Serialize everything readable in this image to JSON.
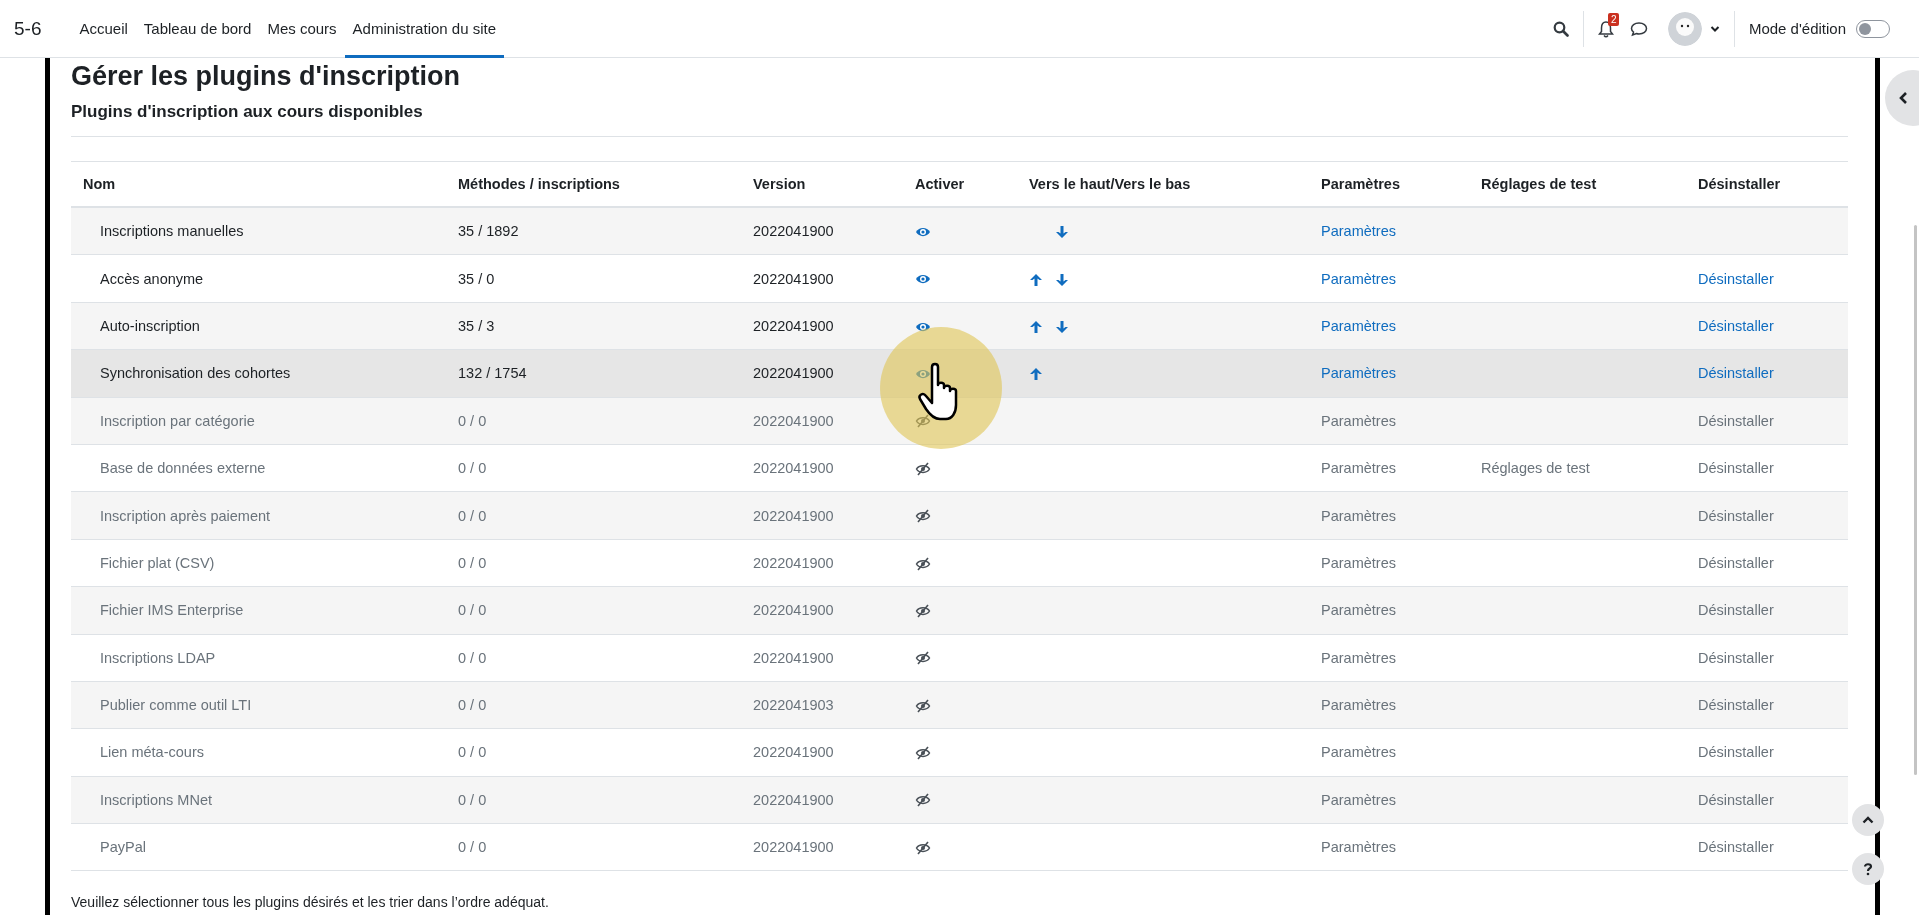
{
  "navbar": {
    "brand": "5-6",
    "items": [
      {
        "label": "Accueil",
        "selected": false
      },
      {
        "label": "Tableau de bord",
        "selected": false
      },
      {
        "label": "Mes cours",
        "selected": false
      },
      {
        "label": "Administration du site",
        "selected": true
      }
    ],
    "notifications_badge": "2",
    "edit_mode": {
      "label": "Mode d'édition",
      "on": false
    }
  },
  "page_title": "Gérer les plugins d'inscription",
  "section_title": "Plugins d'inscription aux cours disponibles",
  "table": {
    "columns": [
      "Nom",
      "Méthodes / inscriptions",
      "Version",
      "Activer",
      "Vers le haut/Vers le bas",
      "Paramètres",
      "Réglages de test",
      "Désinstaller"
    ],
    "rows": [
      {
        "name": "Inscriptions manuelles",
        "counts": "35 / 1892",
        "version": "2022041900",
        "enabled": true,
        "up": false,
        "down": true,
        "settings": "Paramètres",
        "uninstall": null,
        "hovered": false
      },
      {
        "name": "Accès anonyme",
        "counts": "35 / 0",
        "version": "2022041900",
        "enabled": true,
        "up": true,
        "down": true,
        "settings": "Paramètres",
        "uninstall": "Désinstaller",
        "hovered": false
      },
      {
        "name": "Auto-inscription",
        "counts": "35 / 3",
        "version": "2022041900",
        "enabled": true,
        "up": true,
        "down": true,
        "settings": "Paramètres",
        "uninstall": "Désinstaller",
        "hovered": false
      },
      {
        "name": "Synchronisation des cohortes",
        "counts": "132 / 1754",
        "version": "2022041900",
        "enabled": true,
        "up": true,
        "down": false,
        "settings": "Paramètres",
        "uninstall": "Désinstaller",
        "hovered": true
      },
      {
        "name": "Inscription par catégorie",
        "counts": "0 / 0",
        "version": "2022041900",
        "enabled": false,
        "up": false,
        "down": false,
        "settings": "Paramètres",
        "uninstall": "Désinstaller",
        "hovered": false
      },
      {
        "name": "Base de données externe",
        "counts": "0 / 0",
        "version": "2022041900",
        "enabled": false,
        "up": false,
        "down": false,
        "settings": "Paramètres",
        "test": "Réglages de test",
        "uninstall": "Désinstaller",
        "hovered": false
      },
      {
        "name": "Inscription après paiement",
        "counts": "0 / 0",
        "version": "2022041900",
        "enabled": false,
        "up": false,
        "down": false,
        "settings": "Paramètres",
        "uninstall": "Désinstaller",
        "hovered": false
      },
      {
        "name": "Fichier plat (CSV)",
        "counts": "0 / 0",
        "version": "2022041900",
        "enabled": false,
        "up": false,
        "down": false,
        "settings": "Paramètres",
        "uninstall": "Désinstaller",
        "hovered": false
      },
      {
        "name": "Fichier IMS Enterprise",
        "counts": "0 / 0",
        "version": "2022041900",
        "enabled": false,
        "up": false,
        "down": false,
        "settings": "Paramètres",
        "uninstall": "Désinstaller",
        "hovered": false
      },
      {
        "name": "Inscriptions LDAP",
        "counts": "0 / 0",
        "version": "2022041900",
        "enabled": false,
        "up": false,
        "down": false,
        "settings": "Paramètres",
        "uninstall": "Désinstaller",
        "hovered": false
      },
      {
        "name": "Publier comme outil LTI",
        "counts": "0 / 0",
        "version": "2022041903",
        "enabled": false,
        "up": false,
        "down": false,
        "settings": "Paramètres",
        "uninstall": "Désinstaller",
        "hovered": false
      },
      {
        "name": "Lien méta-cours",
        "counts": "0 / 0",
        "version": "2022041900",
        "enabled": false,
        "up": false,
        "down": false,
        "settings": "Paramètres",
        "uninstall": "Désinstaller",
        "hovered": false
      },
      {
        "name": "Inscriptions MNet",
        "counts": "0 / 0",
        "version": "2022041900",
        "enabled": false,
        "up": false,
        "down": false,
        "settings": "Paramètres",
        "uninstall": "Désinstaller",
        "hovered": false
      },
      {
        "name": "PayPal",
        "counts": "0 / 0",
        "version": "2022041900",
        "enabled": false,
        "up": false,
        "down": false,
        "settings": "Paramètres",
        "uninstall": "Désinstaller",
        "hovered": false
      }
    ]
  },
  "footer_note": "Veuillez sélectionner tous les plugins désirés et les trier dans l’ordre adéquat."
}
